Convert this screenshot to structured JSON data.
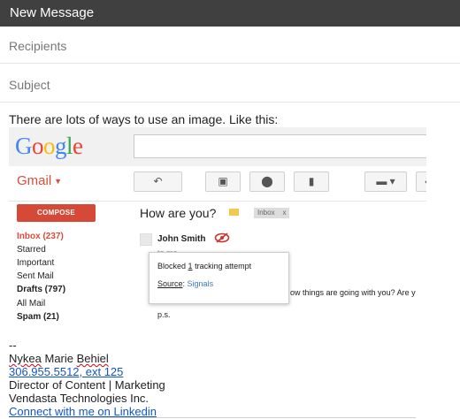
{
  "window": {
    "title": "New Message"
  },
  "compose": {
    "recipients_placeholder": "Recipients",
    "subject_placeholder": "Subject",
    "body_intro": "There are lots of ways to use an image. Like this:"
  },
  "embedded": {
    "logo": {
      "G": "G",
      "o1": "o",
      "o2": "o",
      "g": "g",
      "l": "l",
      "e": "e"
    },
    "gmail_label": "Gmail",
    "compose_button": "COMPOSE",
    "nav": [
      {
        "label": "Inbox (237)"
      },
      {
        "label": "Starred"
      },
      {
        "label": "Important"
      },
      {
        "label": "Sent Mail"
      },
      {
        "label": "Drafts (797)"
      },
      {
        "label": "All Mail"
      },
      {
        "label": "Spam (21)"
      }
    ],
    "subject": "How are you?",
    "inbox_chip": "Inbox",
    "inbox_chip_close": "x",
    "sender": "John Smith",
    "to_me": "to me",
    "message_fragment": "ow things are going with you? Are y",
    "ps": "p.s.",
    "popup": {
      "blocked_prefix": "Blocked",
      "blocked_count": "1",
      "blocked_suffix": "tracking attempt",
      "source_label": "Source",
      "source_value": "Signals"
    }
  },
  "signature": {
    "dashes": "--",
    "first_name": "Nykea",
    "rest_name": "Marie",
    "last_name": "Behiel",
    "phone": "306.955.5512, ext 125",
    "title": "Director of Content | Marketing",
    "company": "Vendasta Technologies Inc.",
    "linkedin": "Connect with me on Linkedin"
  }
}
